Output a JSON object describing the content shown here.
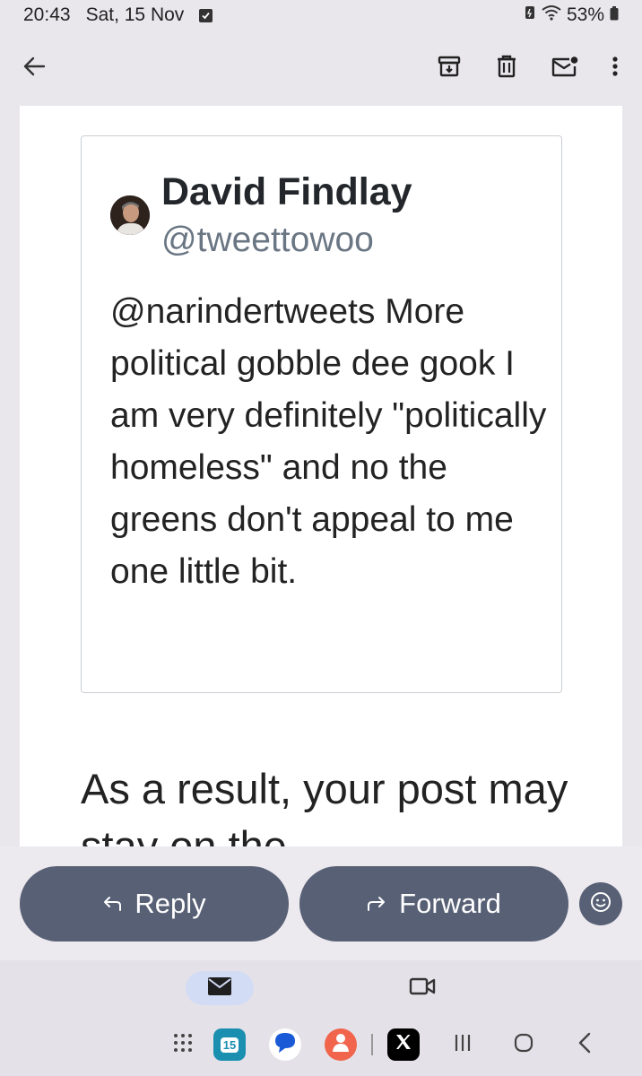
{
  "status_bar": {
    "time": "20:43",
    "date": "Sat, 15 Nov",
    "battery": "53%"
  },
  "app_bar": {
    "back_icon": "arrow-back-icon",
    "actions": [
      "archive-icon",
      "delete-icon",
      "mark-unread-icon",
      "more-vert-icon"
    ]
  },
  "tweet": {
    "author_name": "David Findlay",
    "author_handle": "@tweettowoo",
    "text": "@narindertweets More political gobble dee gook I am very definitely \"politically homeless\" and no the greens don't appeal to me one little bit."
  },
  "body": {
    "text": "As a result, your post may stay on the"
  },
  "reply_bar": {
    "reply_label": "Reply",
    "forward_label": "Forward"
  },
  "taskbar": {
    "calendar_day": "15"
  },
  "colors": {
    "background": "#e9e7ec",
    "pill": "#586075",
    "handle": "#6a7683",
    "nav_active": "#d3dcf5"
  }
}
